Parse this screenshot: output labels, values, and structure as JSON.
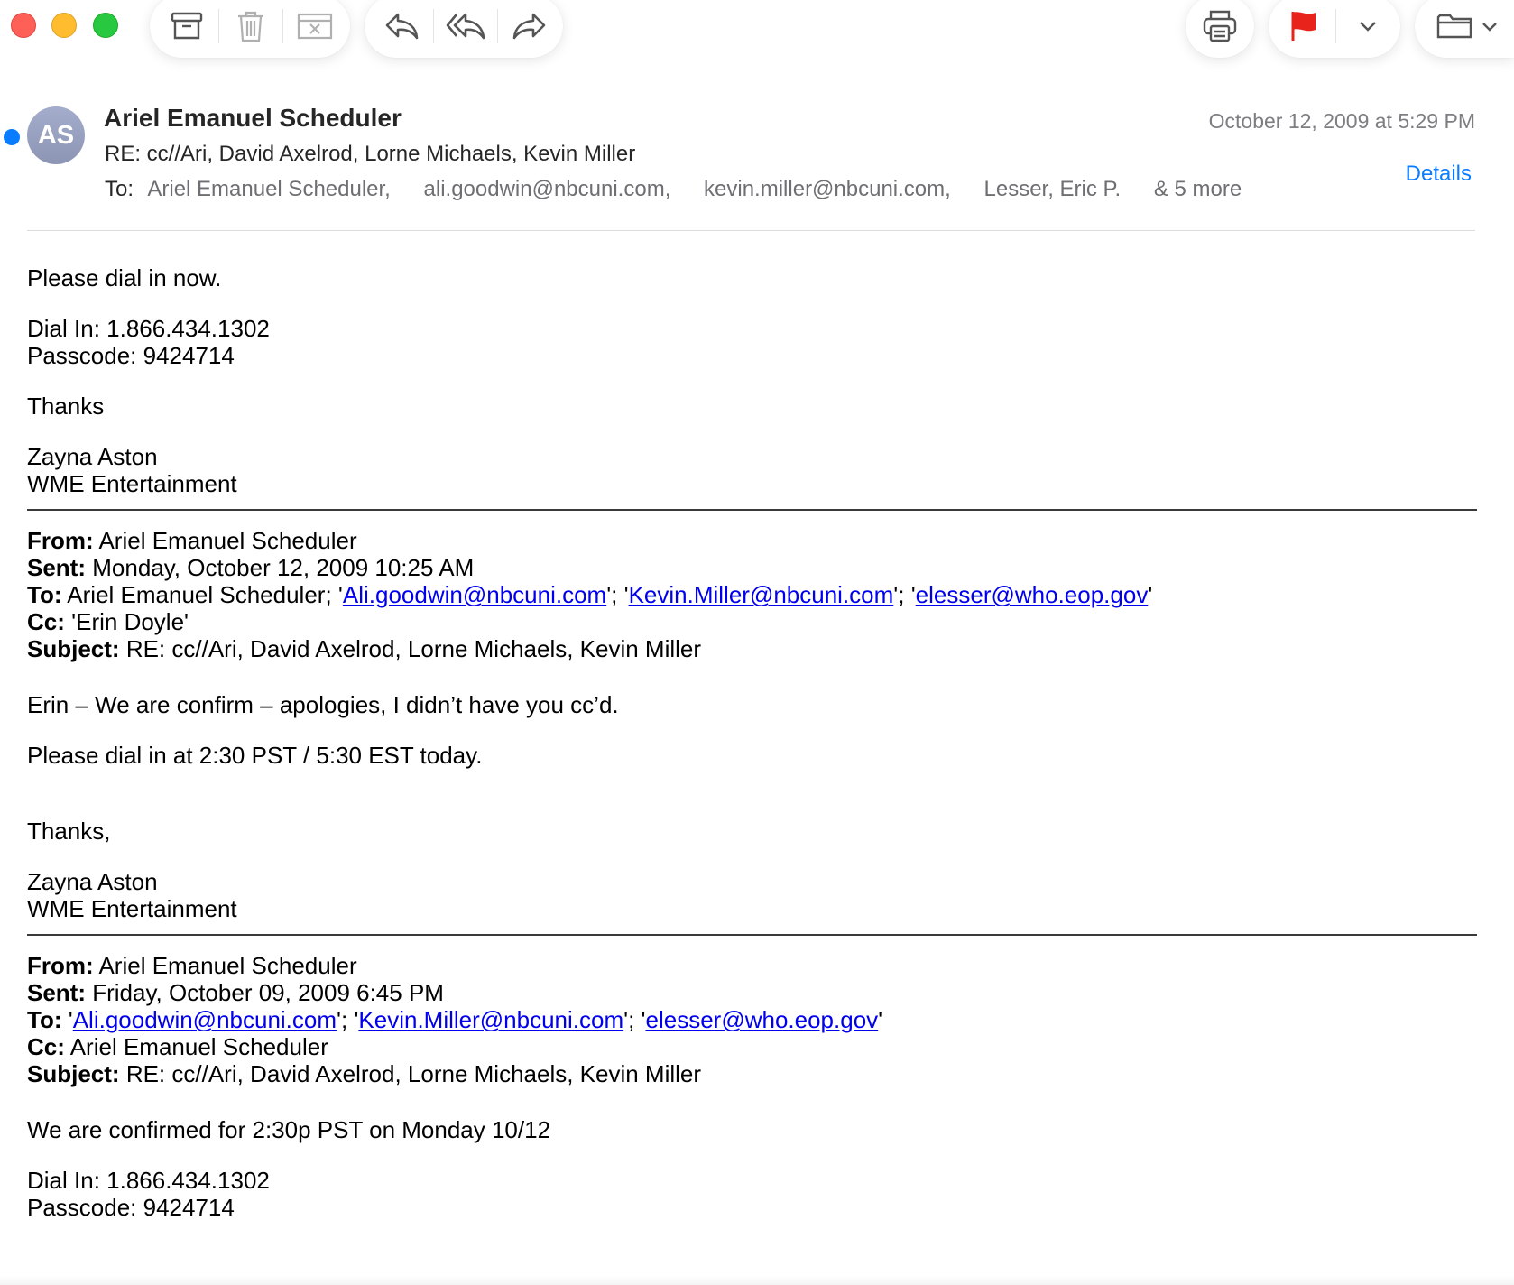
{
  "toolbar": {
    "buttons": [
      "archive-icon",
      "trash-icon",
      "junk-icon",
      "reply-icon",
      "reply-all-icon",
      "forward-icon",
      "print-icon",
      "flag-icon",
      "chevron-down-icon",
      "folder-icon"
    ],
    "flag_color": "#e8231b",
    "traffic_lights": [
      "#fe5f57",
      "#febc2e",
      "#28c840"
    ]
  },
  "header": {
    "avatar_initials": "AS",
    "sender": "Ariel Emanuel Scheduler",
    "subject": "RE: cc//Ari, David Axelrod, Lorne Michaels, Kevin Miller",
    "to_label": "To:",
    "recipients": [
      "Ariel Emanuel Scheduler,",
      "ali.goodwin@nbcuni.com,",
      "kevin.miller@nbcuni.com,",
      "Lesser, Eric P."
    ],
    "more": "& 5 more",
    "date": "October 12, 2009 at 5:29 PM",
    "details_label": "Details",
    "accent_color": "#0a7cff"
  },
  "body": {
    "intro": {
      "p1": "Please dial in now.",
      "dial": "Dial In: 1.866.434.1302",
      "pass": "Passcode: 9424714",
      "thanks": "Thanks",
      "sig_name": "Zayna Aston",
      "sig_company": "WME Entertainment"
    },
    "quote1": {
      "from_label": "From:",
      "from": "Ariel Emanuel Scheduler",
      "sent_label": "Sent:",
      "sent": "Monday, October 12, 2009 10:25 AM",
      "to_label": "To:",
      "to_prefix": "Ariel Emanuel Scheduler; '",
      "link1": "Ali.goodwin@nbcuni.com",
      "mid1": "'; '",
      "link2": "Kevin.Miller@nbcuni.com",
      "mid2": "'; '",
      "link3": "elesser@who.eop.gov",
      "to_suffix": "'",
      "cc_label": "Cc:",
      "cc": "'Erin Doyle'",
      "subject_label": "Subject:",
      "subject": "RE: cc//Ari, David Axelrod, Lorne Michaels, Kevin Miller",
      "p1": "Erin – We are confirm – apologies, I didn’t have you cc’d.",
      "p2": "Please dial in at 2:30 PST / 5:30 EST today.",
      "thanks": "Thanks,",
      "sig_name": "Zayna Aston",
      "sig_company": "WME Entertainment"
    },
    "quote2": {
      "from_label": "From:",
      "from": "Ariel Emanuel Scheduler",
      "sent_label": "Sent:",
      "sent": "Friday, October 09, 2009 6:45 PM",
      "to_label": "To:",
      "to_prefix": "'",
      "link1": "Ali.goodwin@nbcuni.com",
      "mid1": "'; '",
      "link2": "Kevin.Miller@nbcuni.com",
      "mid2": "'; '",
      "link3": "elesser@who.eop.gov",
      "to_suffix": "'",
      "cc_label": "Cc:",
      "cc": "Ariel Emanuel Scheduler",
      "subject_label": "Subject:",
      "subject": "RE: cc//Ari, David Axelrod, Lorne Michaels, Kevin Miller",
      "p1": "We are confirmed for 2:30p PST on Monday 10/12",
      "dial": "Dial In: 1.866.434.1302",
      "pass": "Passcode: 9424714"
    }
  }
}
